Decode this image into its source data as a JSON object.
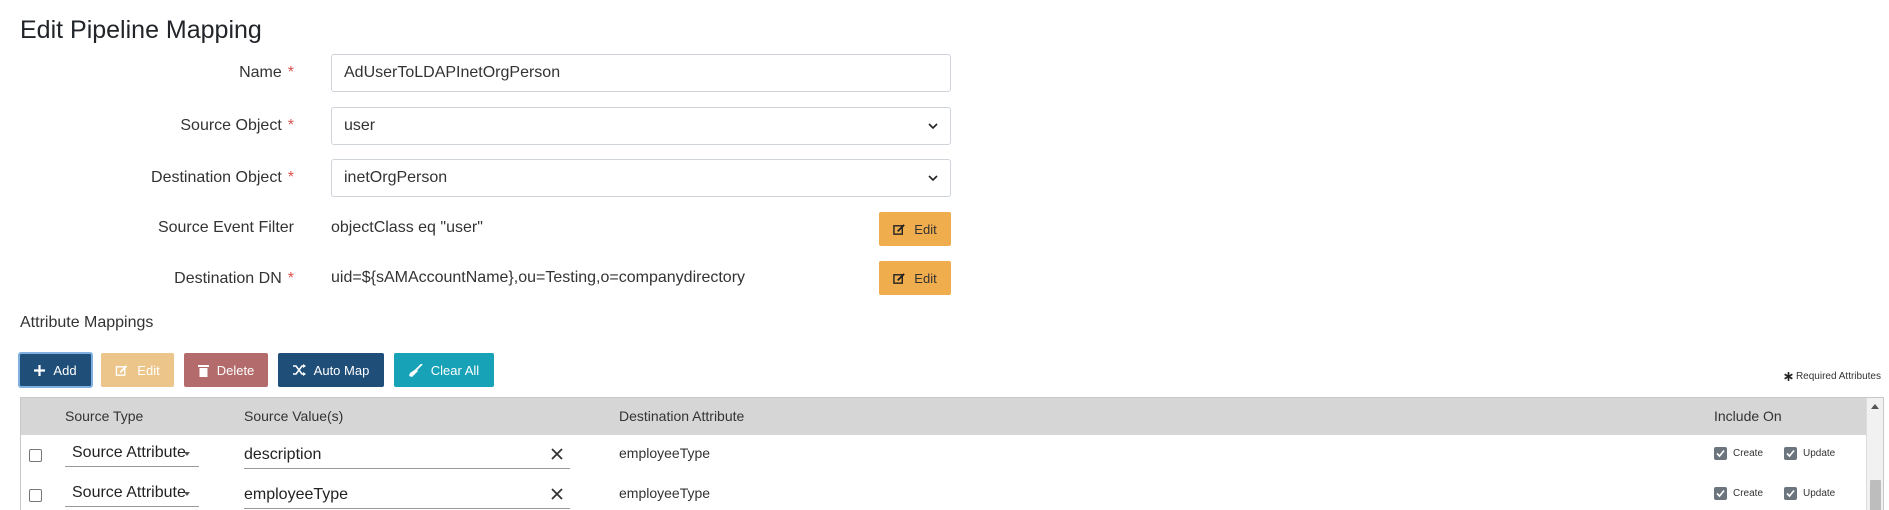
{
  "page": {
    "title": "Edit Pipeline Mapping"
  },
  "form": {
    "name_label": "Name",
    "name_value": "AdUserToLDAPInetOrgPerson",
    "source_object_label": "Source Object",
    "source_object_value": "user",
    "destination_object_label": "Destination Object",
    "destination_object_value": "inetOrgPerson",
    "source_event_filter_label": "Source Event Filter",
    "source_event_filter_value": "objectClass eq \"user\"",
    "destination_dn_label": "Destination DN",
    "destination_dn_value": "uid=${sAMAccountName},ou=Testing,o=companydirectory",
    "required_marker": "*",
    "edit_label": "Edit"
  },
  "attributes": {
    "section_label": "Attribute Mappings",
    "toolbar": {
      "add": "Add",
      "edit": "Edit",
      "delete": "Delete",
      "auto_map": "Auto Map",
      "clear_all": "Clear All"
    },
    "required_note": "Required Attributes",
    "columns": {
      "source_type": "Source Type",
      "source_values": "Source Value(s)",
      "destination_attribute": "Destination Attribute",
      "include_on": "Include On"
    },
    "rows": [
      {
        "source_type": "Source Attribute",
        "source_value": "description",
        "destination_attribute": "employeeType",
        "create_label": "Create",
        "update_label": "Update"
      },
      {
        "source_type": "Source Attribute",
        "source_value": "employeeType",
        "destination_attribute": "employeeType",
        "create_label": "Create",
        "update_label": "Update"
      }
    ]
  },
  "colors": {
    "primary": "#1f4e79",
    "warning": "#f0ad4e",
    "danger": "#b36b6b",
    "info": "#17a2b8",
    "required": "#d9534f"
  }
}
